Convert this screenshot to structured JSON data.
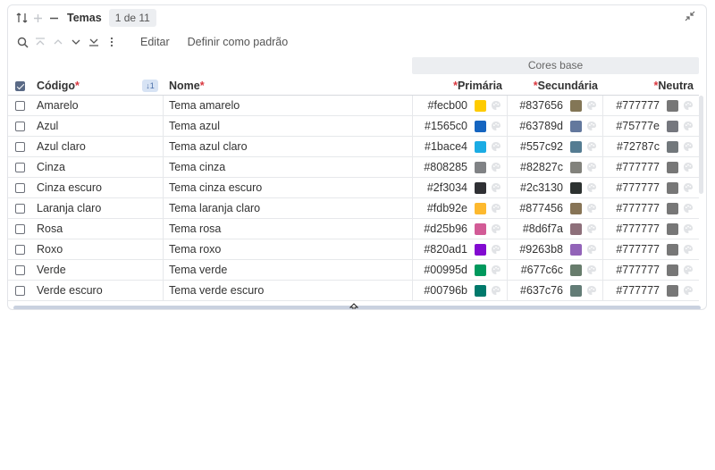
{
  "window": {
    "title": "Temas",
    "pager": "1 de 11"
  },
  "toolbar": {
    "edit": "Editar",
    "set_default": "Definir como padrão"
  },
  "group_header": "Cores base",
  "columns": {
    "code": "Código",
    "name": "Nome",
    "primary": "Primária",
    "secondary": "Secundária",
    "neutral": "Neutra",
    "required_mark": "*",
    "sort_badge": "↓1"
  },
  "rows": [
    {
      "code": "Amarelo",
      "name": "Tema amarelo",
      "primary": "#fecb00",
      "secondary": "#837656",
      "neutral": "#777777"
    },
    {
      "code": "Azul",
      "name": "Tema azul",
      "primary": "#1565c0",
      "secondary": "#63789d",
      "neutral": "#75777e"
    },
    {
      "code": "Azul claro",
      "name": "Tema azul claro",
      "primary": "#1bace4",
      "secondary": "#557c92",
      "neutral": "#72787c"
    },
    {
      "code": "Cinza",
      "name": "Tema cinza",
      "primary": "#808285",
      "secondary": "#82827c",
      "neutral": "#777777"
    },
    {
      "code": "Cinza escuro",
      "name": "Tema cinza escuro",
      "primary": "#2f3034",
      "secondary": "#2c3130",
      "neutral": "#777777"
    },
    {
      "code": "Laranja claro",
      "name": "Tema laranja claro",
      "primary": "#fdb92e",
      "secondary": "#877456",
      "neutral": "#777777"
    },
    {
      "code": "Rosa",
      "name": "Tema rosa",
      "primary": "#d25b96",
      "secondary": "#8d6f7a",
      "neutral": "#777777"
    },
    {
      "code": "Roxo",
      "name": "Tema roxo",
      "primary": "#820ad1",
      "secondary": "#9263b8",
      "neutral": "#777777"
    },
    {
      "code": "Verde",
      "name": "Tema verde",
      "primary": "#00995d",
      "secondary": "#677c6c",
      "neutral": "#777777"
    },
    {
      "code": "Verde escuro",
      "name": "Tema verde escuro",
      "primary": "#00796b",
      "secondary": "#637c76",
      "neutral": "#777777"
    }
  ],
  "icons": {
    "refresh": "refresh-icon",
    "add": "plus-icon",
    "remove": "minus-icon",
    "collapse": "collapse-icon",
    "search": "search-icon",
    "first": "first-icon",
    "prev": "chevron-up-icon",
    "next": "chevron-down-icon",
    "last": "last-icon",
    "more": "more-vertical-icon",
    "palette": "palette-icon"
  }
}
